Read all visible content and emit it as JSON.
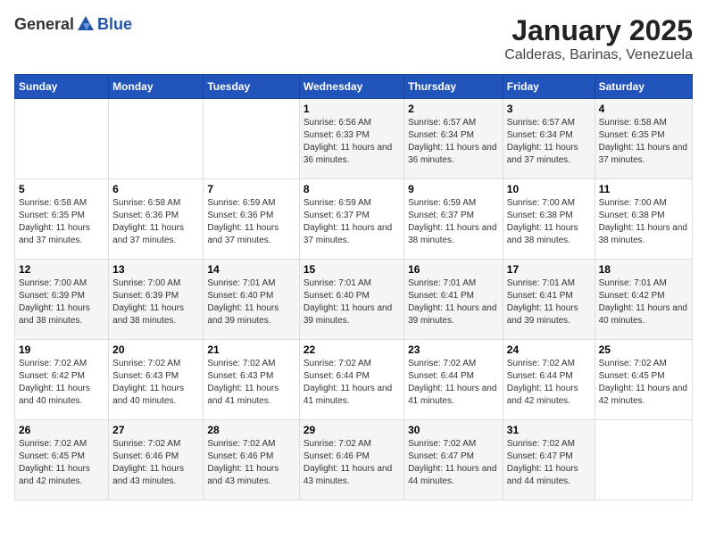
{
  "header": {
    "logo_general": "General",
    "logo_blue": "Blue",
    "title": "January 2025",
    "subtitle": "Calderas, Barinas, Venezuela"
  },
  "days_of_week": [
    "Sunday",
    "Monday",
    "Tuesday",
    "Wednesday",
    "Thursday",
    "Friday",
    "Saturday"
  ],
  "weeks": [
    [
      {
        "day": "",
        "sunrise": "",
        "sunset": "",
        "daylight": ""
      },
      {
        "day": "",
        "sunrise": "",
        "sunset": "",
        "daylight": ""
      },
      {
        "day": "",
        "sunrise": "",
        "sunset": "",
        "daylight": ""
      },
      {
        "day": "1",
        "sunrise": "Sunrise: 6:56 AM",
        "sunset": "Sunset: 6:33 PM",
        "daylight": "Daylight: 11 hours and 36 minutes."
      },
      {
        "day": "2",
        "sunrise": "Sunrise: 6:57 AM",
        "sunset": "Sunset: 6:34 PM",
        "daylight": "Daylight: 11 hours and 36 minutes."
      },
      {
        "day": "3",
        "sunrise": "Sunrise: 6:57 AM",
        "sunset": "Sunset: 6:34 PM",
        "daylight": "Daylight: 11 hours and 37 minutes."
      },
      {
        "day": "4",
        "sunrise": "Sunrise: 6:58 AM",
        "sunset": "Sunset: 6:35 PM",
        "daylight": "Daylight: 11 hours and 37 minutes."
      }
    ],
    [
      {
        "day": "5",
        "sunrise": "Sunrise: 6:58 AM",
        "sunset": "Sunset: 6:35 PM",
        "daylight": "Daylight: 11 hours and 37 minutes."
      },
      {
        "day": "6",
        "sunrise": "Sunrise: 6:58 AM",
        "sunset": "Sunset: 6:36 PM",
        "daylight": "Daylight: 11 hours and 37 minutes."
      },
      {
        "day": "7",
        "sunrise": "Sunrise: 6:59 AM",
        "sunset": "Sunset: 6:36 PM",
        "daylight": "Daylight: 11 hours and 37 minutes."
      },
      {
        "day": "8",
        "sunrise": "Sunrise: 6:59 AM",
        "sunset": "Sunset: 6:37 PM",
        "daylight": "Daylight: 11 hours and 37 minutes."
      },
      {
        "day": "9",
        "sunrise": "Sunrise: 6:59 AM",
        "sunset": "Sunset: 6:37 PM",
        "daylight": "Daylight: 11 hours and 38 minutes."
      },
      {
        "day": "10",
        "sunrise": "Sunrise: 7:00 AM",
        "sunset": "Sunset: 6:38 PM",
        "daylight": "Daylight: 11 hours and 38 minutes."
      },
      {
        "day": "11",
        "sunrise": "Sunrise: 7:00 AM",
        "sunset": "Sunset: 6:38 PM",
        "daylight": "Daylight: 11 hours and 38 minutes."
      }
    ],
    [
      {
        "day": "12",
        "sunrise": "Sunrise: 7:00 AM",
        "sunset": "Sunset: 6:39 PM",
        "daylight": "Daylight: 11 hours and 38 minutes."
      },
      {
        "day": "13",
        "sunrise": "Sunrise: 7:00 AM",
        "sunset": "Sunset: 6:39 PM",
        "daylight": "Daylight: 11 hours and 38 minutes."
      },
      {
        "day": "14",
        "sunrise": "Sunrise: 7:01 AM",
        "sunset": "Sunset: 6:40 PM",
        "daylight": "Daylight: 11 hours and 39 minutes."
      },
      {
        "day": "15",
        "sunrise": "Sunrise: 7:01 AM",
        "sunset": "Sunset: 6:40 PM",
        "daylight": "Daylight: 11 hours and 39 minutes."
      },
      {
        "day": "16",
        "sunrise": "Sunrise: 7:01 AM",
        "sunset": "Sunset: 6:41 PM",
        "daylight": "Daylight: 11 hours and 39 minutes."
      },
      {
        "day": "17",
        "sunrise": "Sunrise: 7:01 AM",
        "sunset": "Sunset: 6:41 PM",
        "daylight": "Daylight: 11 hours and 39 minutes."
      },
      {
        "day": "18",
        "sunrise": "Sunrise: 7:01 AM",
        "sunset": "Sunset: 6:42 PM",
        "daylight": "Daylight: 11 hours and 40 minutes."
      }
    ],
    [
      {
        "day": "19",
        "sunrise": "Sunrise: 7:02 AM",
        "sunset": "Sunset: 6:42 PM",
        "daylight": "Daylight: 11 hours and 40 minutes."
      },
      {
        "day": "20",
        "sunrise": "Sunrise: 7:02 AM",
        "sunset": "Sunset: 6:43 PM",
        "daylight": "Daylight: 11 hours and 40 minutes."
      },
      {
        "day": "21",
        "sunrise": "Sunrise: 7:02 AM",
        "sunset": "Sunset: 6:43 PM",
        "daylight": "Daylight: 11 hours and 41 minutes."
      },
      {
        "day": "22",
        "sunrise": "Sunrise: 7:02 AM",
        "sunset": "Sunset: 6:44 PM",
        "daylight": "Daylight: 11 hours and 41 minutes."
      },
      {
        "day": "23",
        "sunrise": "Sunrise: 7:02 AM",
        "sunset": "Sunset: 6:44 PM",
        "daylight": "Daylight: 11 hours and 41 minutes."
      },
      {
        "day": "24",
        "sunrise": "Sunrise: 7:02 AM",
        "sunset": "Sunset: 6:44 PM",
        "daylight": "Daylight: 11 hours and 42 minutes."
      },
      {
        "day": "25",
        "sunrise": "Sunrise: 7:02 AM",
        "sunset": "Sunset: 6:45 PM",
        "daylight": "Daylight: 11 hours and 42 minutes."
      }
    ],
    [
      {
        "day": "26",
        "sunrise": "Sunrise: 7:02 AM",
        "sunset": "Sunset: 6:45 PM",
        "daylight": "Daylight: 11 hours and 42 minutes."
      },
      {
        "day": "27",
        "sunrise": "Sunrise: 7:02 AM",
        "sunset": "Sunset: 6:46 PM",
        "daylight": "Daylight: 11 hours and 43 minutes."
      },
      {
        "day": "28",
        "sunrise": "Sunrise: 7:02 AM",
        "sunset": "Sunset: 6:46 PM",
        "daylight": "Daylight: 11 hours and 43 minutes."
      },
      {
        "day": "29",
        "sunrise": "Sunrise: 7:02 AM",
        "sunset": "Sunset: 6:46 PM",
        "daylight": "Daylight: 11 hours and 43 minutes."
      },
      {
        "day": "30",
        "sunrise": "Sunrise: 7:02 AM",
        "sunset": "Sunset: 6:47 PM",
        "daylight": "Daylight: 11 hours and 44 minutes."
      },
      {
        "day": "31",
        "sunrise": "Sunrise: 7:02 AM",
        "sunset": "Sunset: 6:47 PM",
        "daylight": "Daylight: 11 hours and 44 minutes."
      },
      {
        "day": "",
        "sunrise": "",
        "sunset": "",
        "daylight": ""
      }
    ]
  ]
}
